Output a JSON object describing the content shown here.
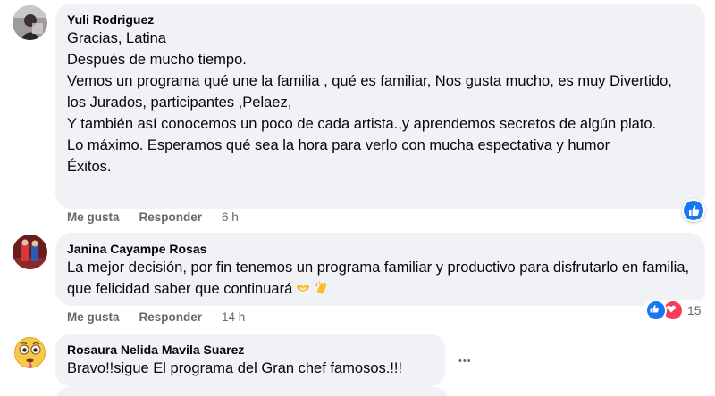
{
  "comments": [
    {
      "author": "Yuli Rodriguez",
      "text": "Gracias, Latina\nDespués de mucho tiempo.\nVemos un programa qué une la familia , qué es familiar, Nos gusta mucho, es muy Divertido, los Jurados, participantes ,Pelaez,\nY también así conocemos un poco de cada artista.,y aprendemos secretos de algún plato.\nLo máximo. Esperamos qué sea la hora para verlo con mucha espectativa y humor\nÉxitos.",
      "like_label": "Me gusta",
      "reply_label": "Responder",
      "time": "6 h",
      "reactions": [
        "like-icon"
      ]
    },
    {
      "author": "Janina Cayampe Rosas",
      "text": "La mejor decisión, por fin tenemos un programa familiar y productivo para disfrutarlo en familia, que felicidad saber que continuará",
      "like_label": "Me gusta",
      "reply_label": "Responder",
      "time": "14 h",
      "reactions": [
        "like-icon",
        "love-icon"
      ],
      "reaction_count": "15"
    },
    {
      "author": "Rosaura Nelida Mavila Suarez",
      "text": "Bravo!!sigue El programa del Gran chef famosos.!!!",
      "more_label": "•••"
    }
  ],
  "colors": {
    "bubble": "#f0f2f5",
    "meta": "#65676b",
    "like_blue": "#1877f2",
    "love_red": "#f33e58"
  }
}
